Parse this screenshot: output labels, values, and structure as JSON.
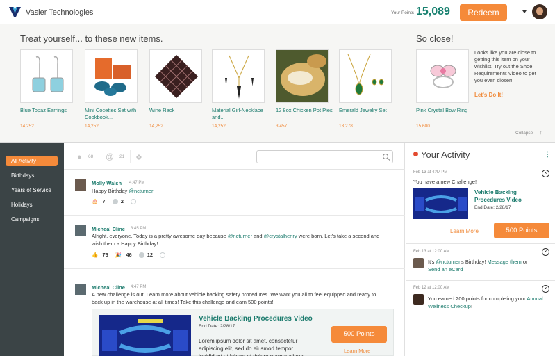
{
  "header": {
    "brand": "Vasler Technologies",
    "points_label": "Your Points",
    "points_value": "15,089",
    "redeem_label": "Redeem"
  },
  "rewards": {
    "title": "Treat yourself... to these new items.",
    "products": [
      {
        "name": "Blue Topaz Earrings",
        "points": "14,252"
      },
      {
        "name": "Mini Cocettes Set with Cookbook...",
        "points": "14,252"
      },
      {
        "name": "Wine Rack",
        "points": "14,252"
      },
      {
        "name": "Material Girl-Necklace and...",
        "points": "14,252"
      },
      {
        "name": "12 8ox Chicken Pot Pies",
        "points": "3,457"
      },
      {
        "name": "Emerald Jewelry Set",
        "points": "13,278"
      }
    ],
    "close_title": "So close!",
    "close_product": {
      "name": "Pink Crystal Bow Ring",
      "points": "15,600"
    },
    "wish_text": "Looks like you are close to getting this item on your wishlist. Try out the Shoe Requirements Video to get you even closer!",
    "wish_link": "Let's Do It!",
    "collapse": "Collapse"
  },
  "sidebar": {
    "items": [
      "All Activity",
      "Birthdays",
      "Years of Service",
      "Holidays",
      "Campaigns"
    ]
  },
  "toolbar": {
    "people_count": "68",
    "mention_count": "21"
  },
  "posts": [
    {
      "name": "Molly Walsh",
      "time": "4:47 PM",
      "text_pre": "Happy Birthday ",
      "mention1": "@ncturner",
      "text_post": "!",
      "reactions": [
        "7",
        "2"
      ]
    },
    {
      "name": "Micheal Cline",
      "time": "3:45 PM",
      "text_pre": "Alright, everyone. Today is a pretty awesome day because ",
      "mention1": "@ncturner",
      "text_mid": " and ",
      "mention2": "@crystalhenry",
      "text_post": " were born. Let's take a second and wish them a Happy Birthday!",
      "reactions": [
        "76",
        "46",
        "12"
      ]
    },
    {
      "name": "Micheal Cline",
      "time": "4:47 PM",
      "text": "A new challenge is out! Learn more about vehicle backing safety procedures. We want you all to feel equipped and ready to back up in the warehouse at all times! Take this challenge and earn 500 points!",
      "card": {
        "title": "Vehicle Backing Procedures Video",
        "date": "End Date: 2/28/17",
        "desc": "Lorem ipsum dolor sit amet, consectetur adipiscing elit, sed do eiusmod tempor incididunt ut labore et dolore magna aliqua.",
        "button": "500 Points",
        "more": "Learn More"
      }
    }
  ],
  "activity": {
    "title": "Your Activity",
    "items": [
      {
        "time": "Feb 13 at 4:47 PM",
        "text": "You have a new Challenge!",
        "challenge_title": "Vehicle Backing Procedures Video",
        "challenge_date": "End Date: 2/28/17",
        "more": "Learn More",
        "button": "500 Points"
      },
      {
        "time": "Feb 13 at 12:00 AM",
        "text_pre": "It's ",
        "mention": "@ncturner",
        "text_mid": "'s Birthday! ",
        "link1": "Message them",
        "text_or": " or",
        "link2": "Send an eCard"
      },
      {
        "time": "Feb 12 at 12:00 AM",
        "text": "You earned 200 points for completing your ",
        "link": "Annual Wellness Checkup",
        "text_post": "!"
      }
    ]
  }
}
